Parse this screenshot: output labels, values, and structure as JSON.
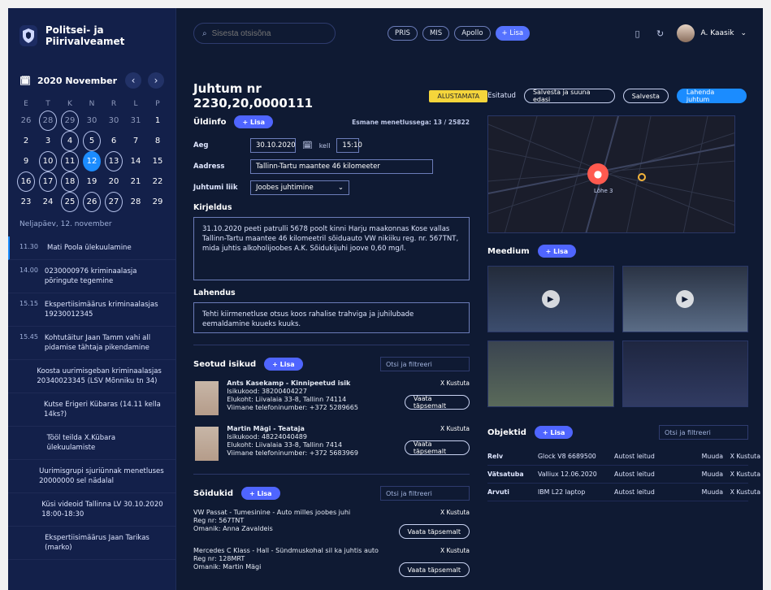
{
  "brand": {
    "title": "Politsei- ja Piirivalveamet"
  },
  "calendar": {
    "month_label": "2020 November",
    "dow": [
      "E",
      "T",
      "K",
      "N",
      "R",
      "L",
      "P"
    ],
    "weeks": [
      [
        {
          "d": "26",
          "s": "muted"
        },
        {
          "d": "28",
          "s": "muted ring"
        },
        {
          "d": "29",
          "s": "muted ring"
        },
        {
          "d": "30",
          "s": "muted"
        },
        {
          "d": "30",
          "s": "muted"
        },
        {
          "d": "31",
          "s": "muted"
        },
        {
          "d": "1",
          "s": ""
        }
      ],
      [
        {
          "d": "2",
          "s": ""
        },
        {
          "d": "3",
          "s": ""
        },
        {
          "d": "4",
          "s": "ring"
        },
        {
          "d": "5",
          "s": "ring"
        },
        {
          "d": "6",
          "s": ""
        },
        {
          "d": "7",
          "s": ""
        },
        {
          "d": "8",
          "s": ""
        }
      ],
      [
        {
          "d": "9",
          "s": ""
        },
        {
          "d": "10",
          "s": "ring"
        },
        {
          "d": "11",
          "s": "ring"
        },
        {
          "d": "12",
          "s": "active"
        },
        {
          "d": "13",
          "s": "ring"
        },
        {
          "d": "14",
          "s": ""
        },
        {
          "d": "15",
          "s": ""
        }
      ],
      [
        {
          "d": "16",
          "s": "ring"
        },
        {
          "d": "17",
          "s": "ring"
        },
        {
          "d": "18",
          "s": "ring"
        },
        {
          "d": "19",
          "s": ""
        },
        {
          "d": "20",
          "s": ""
        },
        {
          "d": "21",
          "s": ""
        },
        {
          "d": "22",
          "s": ""
        }
      ],
      [
        {
          "d": "23",
          "s": ""
        },
        {
          "d": "24",
          "s": ""
        },
        {
          "d": "25",
          "s": "ring"
        },
        {
          "d": "26",
          "s": "ring"
        },
        {
          "d": "27",
          "s": "ring"
        },
        {
          "d": "28",
          "s": ""
        },
        {
          "d": "29",
          "s": ""
        }
      ]
    ],
    "agenda_label": "Neljapäev, 12. november",
    "agenda": [
      {
        "time": "11.30",
        "text": "Mati Poola ülekuulamine",
        "current": true
      },
      {
        "time": "14.00",
        "text": "0230000976 kriminaalasja põringute tegemine",
        "current": false
      },
      {
        "time": "15.15",
        "text": "Ekspertiisimäärus kriminaalasjas 19230012345",
        "current": false
      },
      {
        "time": "15.45",
        "text": "Kohtutäitur Jaan Tamm vahi all pidamise tähtaja pikendamine",
        "current": false
      },
      {
        "time": "",
        "text": "Koosta uurimisgeban kriminaalasjas 20340023345 (LSV Mõnniku tn 34)",
        "current": false
      },
      {
        "time": "",
        "text": "Kutse Erigeri Kübaras (14.11 kella 14ks?)",
        "current": false
      },
      {
        "time": "",
        "text": "Tööl teilda X.Kübara ülekuulamiste",
        "current": false
      },
      {
        "time": "",
        "text": "Uurimisgrupi sjuriünnak menetluses 20000000 sel nädalal",
        "current": false
      },
      {
        "time": "",
        "text": "Küsi videoid Tallinna LV 30.10.2020 18:00-18:30",
        "current": false
      },
      {
        "time": "",
        "text": "Ekspertiisimäärus Jaan Tarikas (marko)",
        "current": false
      }
    ]
  },
  "topbar": {
    "search_placeholder": "Sisesta otsisõna",
    "chips": [
      "PRIS",
      "MIS",
      "Apollo",
      "+ Lisa"
    ],
    "user_name": "A. Kaasik"
  },
  "case": {
    "title": "Juhtum nr 2230,20,0000111",
    "badge": "ALUSTAMATA",
    "actions": {
      "label": "Esitatud",
      "save_next": "Salvesta ja suuna edasi",
      "save": "Salvesta",
      "resolve": "Lahenda juhtum"
    }
  },
  "general": {
    "title": "Üldinfo",
    "add": "+ Lisa",
    "meta": "Esmane menetlussega: 13 / 25822",
    "fields": {
      "aeg_label": "Aeg",
      "date": "30.10.2020",
      "kell_label": "kell",
      "time": "15:10",
      "address_label": "Aadress",
      "address": "Tallinn-Tartu maantee 46 kilomeeter",
      "type_label": "Juhtumi liik",
      "type": "Joobes juhtimine"
    },
    "description_title": "Kirjeldus",
    "description": "31.10.2020 peeti patrulli 5678 poolt kinni Harju maakonnas Kose vallas Tallinn-Tartu maantee 46 kilomeetril sõiduauto VW nikiiku reg. nr. 567TNT, mida juhtis alkoholijoobes A.K. Sõidukijuhi joove 0,60 mg/l.",
    "resolution_title": "Lahendus",
    "resolution": "Tehti kiirmenetluse otsus koos rahalise trahviga ja juhilubade eemaldamine kuueks kuuks."
  },
  "persons": {
    "title": "Seotud isikud",
    "add": "+ Lisa",
    "filter": "Otsi ja filtreeri",
    "items": [
      {
        "name": "Ants Kasekamp - Kinnipeetud isik",
        "id": "Isikukood: 38200404227",
        "address": "Elukoht: Liivalaia 33-8, Tallinn 74114",
        "phone": "Viimane telefoninumber: +372 5289665",
        "delete": "X Kustuta",
        "details": "Vaata täpsemalt"
      },
      {
        "name": "Martin Mägi - Teataja",
        "id": "Isikukood: 48224040489",
        "address": "Elukoht: Liivalaia 33-8, Tallinn 7414",
        "phone": "Viimane telefoninumber: +372 5683969",
        "delete": "X Kustuta",
        "details": "Vaata täpsemalt"
      }
    ]
  },
  "vehicles": {
    "title": "Sõidukid",
    "add": "+ Lisa",
    "filter": "Otsi ja filtreeri",
    "items": [
      {
        "line1": "VW Passat - Tumesinine - Auto milles joobes juhi",
        "reg": "Reg nr: 567TNT",
        "owner": "Omanik: Anna Zavaldeis",
        "delete": "X Kustuta",
        "details": "Vaata täpsemalt"
      },
      {
        "line1": "Mercedes C Klass - Hall - Sündmuskohal sil ka juhtis auto",
        "reg": "Reg nr: 128MRT",
        "owner": "Omanik: Martin Mägi",
        "delete": "X Kustuta",
        "details": "Vaata täpsemalt"
      }
    ]
  },
  "map": {
    "pin_label": "Lõhe 3"
  },
  "media": {
    "title": "Meedium",
    "add": "+ Lisa"
  },
  "objects": {
    "title": "Objektid",
    "add": "+ Lisa",
    "filter": "Otsi ja filtreeri",
    "rows": [
      {
        "c1": "Relv",
        "c2": "Glock V8 6689500",
        "c3": "Autost leitud",
        "c4": "Muuda",
        "c5": "X Kustuta"
      },
      {
        "c1": "Vätsatuba",
        "c2": "Valliux 12.06.2020",
        "c3": "Autost leitud",
        "c4": "Muuda",
        "c5": "X Kustuta"
      },
      {
        "c1": "Arvuti",
        "c2": "IBM L22 laptop",
        "c3": "Autost leitud",
        "c4": "Muuda",
        "c5": "X Kustuta"
      }
    ]
  }
}
